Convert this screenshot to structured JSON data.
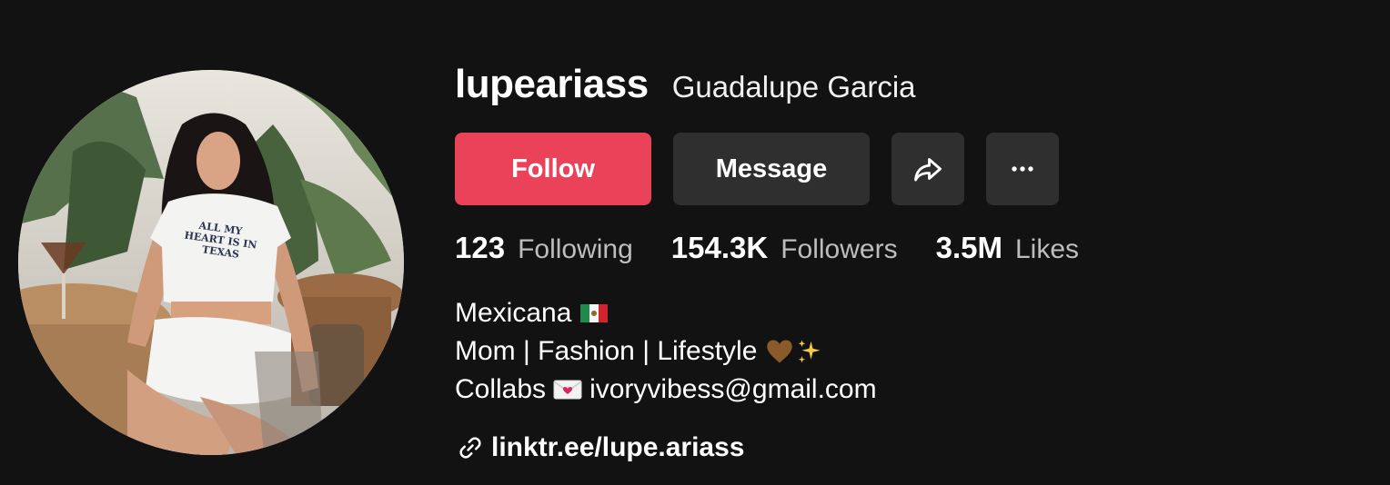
{
  "profile": {
    "username": "lupeariass",
    "nickname": "Guadalupe Garcia",
    "avatar_shirt_text": "ALL MY HEART IS IN TEXAS"
  },
  "actions": {
    "follow_label": "Follow",
    "message_label": "Message",
    "share_icon": "share-arrow-icon",
    "more_icon": "more-dots-icon"
  },
  "stats": {
    "following_count": "123",
    "following_label": "Following",
    "followers_count": "154.3K",
    "followers_label": "Followers",
    "likes_count": "3.5M",
    "likes_label": "Likes"
  },
  "bio": {
    "line1": "Mexicana",
    "line1_emoji": "mexico-flag",
    "line2": "Mom | Fashion | Lifestyle",
    "line2_emojis": [
      "brown-heart",
      "sparkles"
    ],
    "line3_prefix": "Collabs",
    "line3_emoji": "love-letter",
    "line3_email": "ivoryvibess@gmail.com"
  },
  "link": {
    "text": "linktr.ee/lupe.ariass",
    "icon": "link-icon"
  },
  "colors": {
    "background": "#121212",
    "follow_button": "#ea4359",
    "secondary_button": "#2f2f2f",
    "muted_text": "#bdbdbd"
  }
}
